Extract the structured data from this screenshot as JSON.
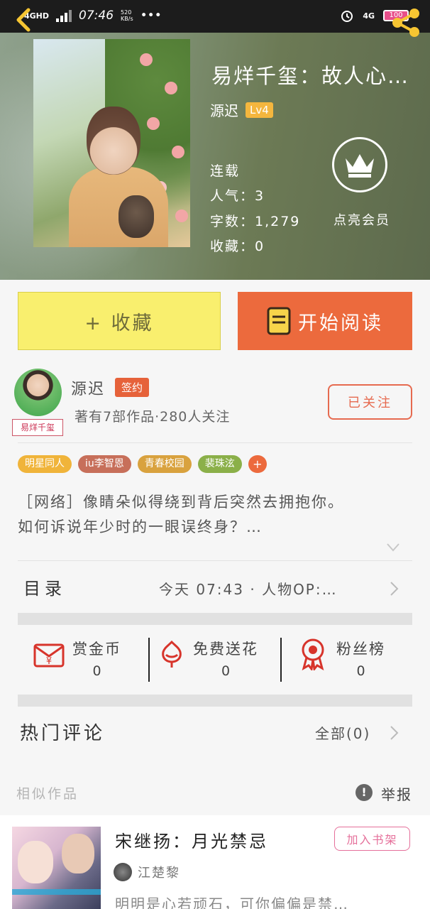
{
  "status_bar": {
    "network": "4GHD",
    "time": "07:46",
    "speed_value": "520",
    "speed_unit": "KB/s",
    "dots": "•••",
    "right_network": "4G",
    "battery": "100"
  },
  "header": {
    "title": "易烊千玺：故人心…",
    "author": "源迟",
    "level_badge": "Lv4",
    "status": "连载",
    "popularity": "人气：3",
    "word_count": "字数：1,279",
    "favorites": "收藏：0",
    "vip_label": "点亮会员",
    "icons": {
      "back": "back-arrow-icon",
      "share": "share-icon",
      "vip": "crown-icon"
    }
  },
  "actions": {
    "favorite_label": "+ 收藏",
    "read_label": "开始阅读"
  },
  "author_section": {
    "name": "源迟",
    "signed_badge": "签约",
    "stats": "著有7部作品·280人关注",
    "avatar_tag": "易烊千玺",
    "follow_label": "已关注"
  },
  "tags": [
    {
      "label": "明星同人",
      "color": "#f0b43a"
    },
    {
      "label": "iu李智恩",
      "color": "#c76f5a"
    },
    {
      "label": "青春校园",
      "color": "#d9a23e"
    },
    {
      "label": "裴珠泫",
      "color": "#8bb049"
    },
    {
      "label": "+",
      "color": "#ec6a3d"
    }
  ],
  "summary": {
    "line1": "［网络］像睛朵似得绕到背后突然去拥抱你。",
    "line2": "如何诉说年少时的一眼误终身？…"
  },
  "catalog": {
    "label": "目录",
    "latest_update": "今天 07:43 · 人物OP:…"
  },
  "stats": {
    "reward": {
      "label": "赏金币",
      "value": "0"
    },
    "flowers": {
      "label": "免费送花",
      "value": "0"
    },
    "fans": {
      "label": "粉丝榜",
      "value": "0"
    }
  },
  "comments": {
    "label": "热门评论",
    "all_label": "全部(0)"
  },
  "similar": {
    "label": "相似作品",
    "report_icon": "!",
    "report_label": "举报",
    "book": {
      "title": "宋继扬：月光禁忌",
      "shelf_label": "加入书架",
      "author": "江楚黎",
      "description": "明明是心若顽石，可你偏偏是禁…"
    }
  },
  "colors": {
    "accent_orange": "#ec6a3d",
    "favorite_yellow": "#f9ef6e",
    "pink": "#e56f9a"
  }
}
